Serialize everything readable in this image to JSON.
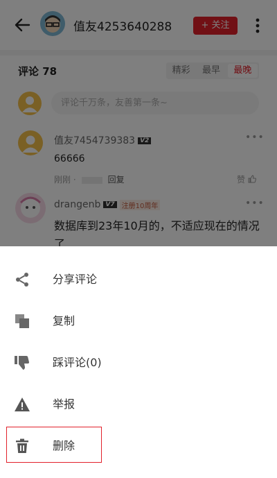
{
  "header": {
    "username": "值友4253640288",
    "follow_label": "+ 关注"
  },
  "comments": {
    "title": "评论 78",
    "sort_tabs": [
      {
        "label": "精彩"
      },
      {
        "label": "最早"
      },
      {
        "label": "最晚"
      }
    ],
    "input_placeholder": "评论千万条，友善第一条~",
    "items": [
      {
        "name": "值友7454739383",
        "level": "V2",
        "text": "66666",
        "time": "刚刚 ·",
        "reply": "回复",
        "like": "赞"
      },
      {
        "name": "drangenb",
        "level": "V7",
        "badge": "注册10周年",
        "text": "数据库到23年10月的，不适应现在的情况了"
      }
    ]
  },
  "action_sheet": {
    "items": [
      {
        "label": "分享评论",
        "icon": "share-icon"
      },
      {
        "label": "复制",
        "icon": "copy-icon"
      },
      {
        "label": "踩评论(0)",
        "icon": "thumbs-down-icon"
      },
      {
        "label": "举报",
        "icon": "warning-icon"
      },
      {
        "label": "删除",
        "icon": "trash-icon"
      }
    ],
    "highlight_color": "#e2202a"
  },
  "colors": {
    "accent": "#e2202a",
    "overlay": "rgba(0,0,0,0.5)"
  }
}
